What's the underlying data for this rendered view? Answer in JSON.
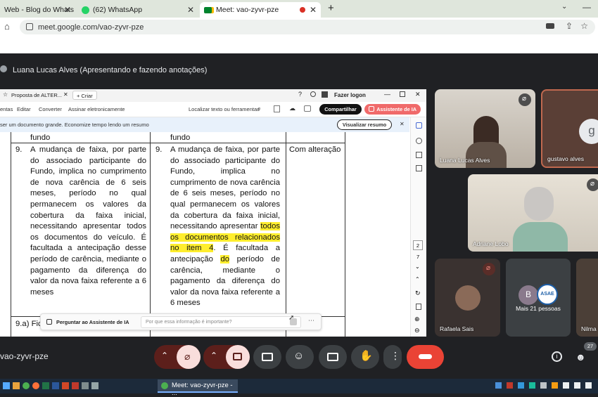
{
  "browser": {
    "tabs": [
      {
        "label": "Web - Blog do Whats"
      },
      {
        "label": "(62) WhatsApp"
      },
      {
        "label": "Meet: vao-zyvr-pze"
      }
    ],
    "url": "meet.google.com/vao-zyvr-pze"
  },
  "meet": {
    "presenter_label": "Luana Lucas Alves (Apresentando e fazendo anotações)",
    "meeting_code": "vao-zyvr-pze",
    "participant_count": "27",
    "more_people": "Mais 21 pessoas"
  },
  "doc": {
    "tab_title": "Proposta de ALTER...",
    "new_tab": "+ Criar",
    "login": "Fazer logon",
    "menu": [
      "entas",
      "Editar",
      "Converter",
      "Assinar eletronicamente"
    ],
    "search": "Localizar texto ou ferramentas",
    "share": "Compartilhar",
    "ai_assistant": "Assistente de IA",
    "banner": "ser um documento grande. Economize tempo lendo um resumo",
    "summary_btn": "Visualizar resumo",
    "ask_ai": "Perguntar ao Assistente de IA",
    "ask_placeholder": "Por que essa informação é importante?",
    "page_current": "2",
    "page_total": "7",
    "col1_prev": "fundo",
    "col2_prev": "fundo",
    "item_no": "9.",
    "col1_text": "A mudança de faixa, por parte do associado participante do Fundo, implica no cumprimento de nova carência de 6 seis meses, período no qual permanecem os valores da cobertura da faixa inicial, necessitando apresentar todos os documentos do veículo. É facultada a antecipação desse período de carência, mediante o pagamento da diferença do valor da nova faixa referente a 6 meses",
    "col2_part1": "A mudança de faixa, por parte do associado participante do Fundo, implica no cumprimento de nova carência de 6 seis meses, período no qual permanecem os valores da cobertura da faixa inicial, necessitando apresentar",
    "col2_hl1": "todos os documentos relacionados no item 4",
    "col2_part2": ". É facultada a antecipação",
    "col2_hl2": "do",
    "col2_part3": "período de carência, mediante o pagamento da diferença do valor da nova faixa referente a 6 meses",
    "col3_text": "Com alteração",
    "next_row": "9.a) Fic"
  },
  "tiles": {
    "t1": "Luana Lucas Alves",
    "t2": "gustavo alves",
    "t2_initial": "g",
    "t3": "Adriane Lobo",
    "t4": "Rafaela Sais",
    "t5": "Nilma",
    "more_initial": "B",
    "asae": "ASAE"
  },
  "taskbar": {
    "window": "Meet: vao-zyvr-pze - ..."
  },
  "colors": {
    "meet_bg": "#202124",
    "hangup": "#ea4335",
    "highlight": "#ffee2e",
    "ai_button": "#f06a6a"
  }
}
